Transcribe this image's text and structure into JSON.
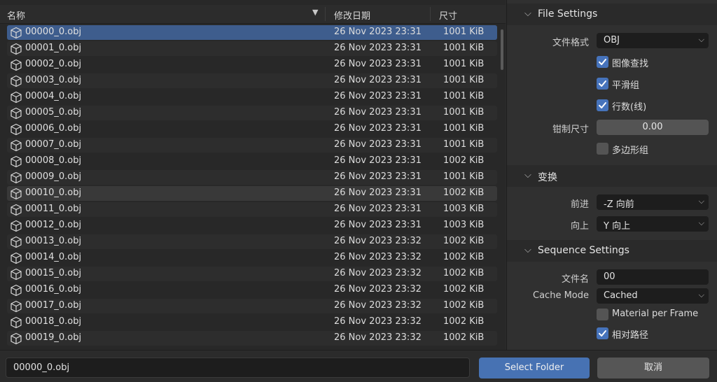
{
  "file_list": {
    "columns": {
      "name": "名称",
      "date": "修改日期",
      "size": "尺寸"
    },
    "files": [
      {
        "name": "00000_0.obj",
        "date": "26 Nov 2023 23:31",
        "size": "1001 KiB"
      },
      {
        "name": "00001_0.obj",
        "date": "26 Nov 2023 23:31",
        "size": "1001 KiB"
      },
      {
        "name": "00002_0.obj",
        "date": "26 Nov 2023 23:31",
        "size": "1001 KiB"
      },
      {
        "name": "00003_0.obj",
        "date": "26 Nov 2023 23:31",
        "size": "1001 KiB"
      },
      {
        "name": "00004_0.obj",
        "date": "26 Nov 2023 23:31",
        "size": "1001 KiB"
      },
      {
        "name": "00005_0.obj",
        "date": "26 Nov 2023 23:31",
        "size": "1001 KiB"
      },
      {
        "name": "00006_0.obj",
        "date": "26 Nov 2023 23:31",
        "size": "1001 KiB"
      },
      {
        "name": "00007_0.obj",
        "date": "26 Nov 2023 23:31",
        "size": "1001 KiB"
      },
      {
        "name": "00008_0.obj",
        "date": "26 Nov 2023 23:31",
        "size": "1002 KiB"
      },
      {
        "name": "00009_0.obj",
        "date": "26 Nov 2023 23:31",
        "size": "1001 KiB"
      },
      {
        "name": "00010_0.obj",
        "date": "26 Nov 2023 23:31",
        "size": "1002 KiB"
      },
      {
        "name": "00011_0.obj",
        "date": "26 Nov 2023 23:31",
        "size": "1003 KiB"
      },
      {
        "name": "00012_0.obj",
        "date": "26 Nov 2023 23:31",
        "size": "1003 KiB"
      },
      {
        "name": "00013_0.obj",
        "date": "26 Nov 2023 23:32",
        "size": "1002 KiB"
      },
      {
        "name": "00014_0.obj",
        "date": "26 Nov 2023 23:32",
        "size": "1002 KiB"
      },
      {
        "name": "00015_0.obj",
        "date": "26 Nov 2023 23:32",
        "size": "1002 KiB"
      },
      {
        "name": "00016_0.obj",
        "date": "26 Nov 2023 23:32",
        "size": "1002 KiB"
      },
      {
        "name": "00017_0.obj",
        "date": "26 Nov 2023 23:32",
        "size": "1002 KiB"
      },
      {
        "name": "00018_0.obj",
        "date": "26 Nov 2023 23:32",
        "size": "1002 KiB"
      },
      {
        "name": "00019_0.obj",
        "date": "26 Nov 2023 23:32",
        "size": "1002 KiB"
      }
    ],
    "selected_index": 0,
    "hovered_index": 10,
    "file_icon": "cube-icon"
  },
  "settings": {
    "file_settings": {
      "title": "File Settings",
      "format_label": "文件格式",
      "format_value": "OBJ",
      "image_search_label": "图像查找",
      "image_search": true,
      "smooth_groups_label": "平滑组",
      "smooth_groups": true,
      "lines_label": "行数(线)",
      "lines": true,
      "clamp_size_label": "钳制尺寸",
      "clamp_size_value": "0.00",
      "polygroups_label": "多边形组",
      "polygroups": false
    },
    "transform": {
      "title": "变换",
      "forward_label": "前进",
      "forward_value": "-Z 向前",
      "up_label": "向上",
      "up_value": "Y 向上"
    },
    "sequence_settings": {
      "title": "Sequence Settings",
      "filename_label": "文件名",
      "filename_value": "00",
      "cache_mode_label": "Cache Mode",
      "cache_mode_value": "Cached",
      "material_per_frame_label": "Material per Frame",
      "material_per_frame": false,
      "relative_path_label": "相对路径",
      "relative_path": true
    }
  },
  "footer": {
    "filename_value": "00000_0.obj",
    "select_button": "Select Folder",
    "cancel_button": "取消"
  },
  "colors": {
    "accent": "#4772b3",
    "selection": "#3e5d8d",
    "checkbox_on": "#4673bb"
  }
}
